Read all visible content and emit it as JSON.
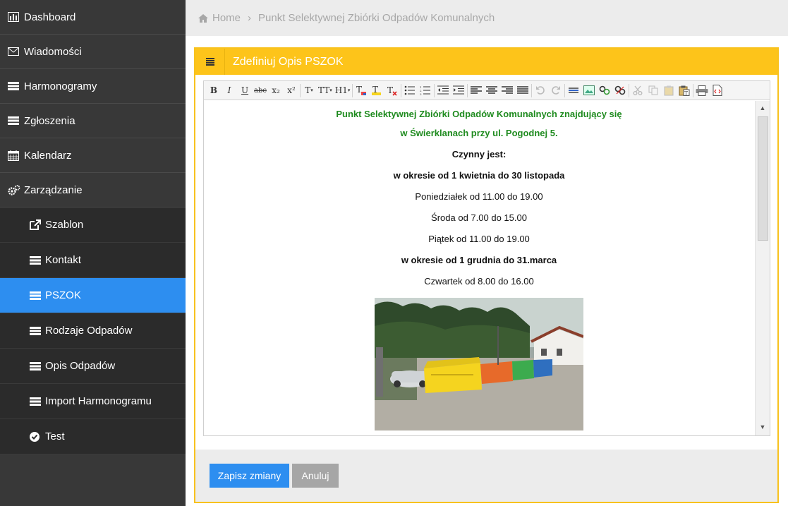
{
  "sidebar": {
    "items": [
      {
        "label": "Dashboard",
        "icon": "bar-chart-icon"
      },
      {
        "label": "Wiadomości",
        "icon": "envelope-icon"
      },
      {
        "label": "Harmonogramy",
        "icon": "list-icon"
      },
      {
        "label": "Zgłoszenia",
        "icon": "list-icon"
      },
      {
        "label": "Kalendarz",
        "icon": "calendar-icon"
      },
      {
        "label": "Zarządzanie",
        "icon": "cogs-icon"
      }
    ],
    "subitems": [
      {
        "label": "Szablon",
        "icon": "external-link-icon"
      },
      {
        "label": "Kontakt",
        "icon": "list-icon"
      },
      {
        "label": "PSZOK",
        "icon": "list-icon",
        "active": true
      },
      {
        "label": "Rodzaje Odpadów",
        "icon": "list-icon"
      },
      {
        "label": "Opis Odpadów",
        "icon": "list-icon"
      },
      {
        "label": "Import Harmonogramu",
        "icon": "list-icon"
      },
      {
        "label": "Test",
        "icon": "check-circle-icon"
      }
    ]
  },
  "breadcrumb": {
    "home": "Home",
    "current": "Punkt Selektywnej Zbiórki Odpadów Komunalnych"
  },
  "panel": {
    "title": "Zdefiniuj Opis PSZOK"
  },
  "editor": {
    "toolbar": {
      "bold": "B",
      "italic": "I",
      "underline": "U",
      "strike": "abc",
      "subscript": "x₂",
      "superscript": "x²",
      "font_size": "T",
      "font_family": "TT",
      "heading": "H1"
    },
    "content": {
      "line1": "Punkt Selektywnej Zbiórki Odpadów Komunalnych znajdujący się",
      "line2": "w Świerklanach przy ul. Pogodnej 5.",
      "line3": "Czynny jest:",
      "line4": "w okresie od 1 kwietnia do 30 listopada",
      "line5": "Poniedziałek od 11.00 do 19.00",
      "line6": "Środa od 7.00 do 15.00",
      "line7": "Piątek od 11.00 do 19.00",
      "line8": "w okresie od 1 grudnia do 31.marca",
      "line9": "Czwartek od 8.00 do 16.00"
    }
  },
  "footer": {
    "save_label": "Zapisz zmiany",
    "cancel_label": "Anuluj"
  },
  "colors": {
    "accent_blue": "#2d8ef0",
    "panel_yellow": "#fdc41a",
    "sidebar_bg": "#383838",
    "green_text": "#1f8b1f"
  }
}
